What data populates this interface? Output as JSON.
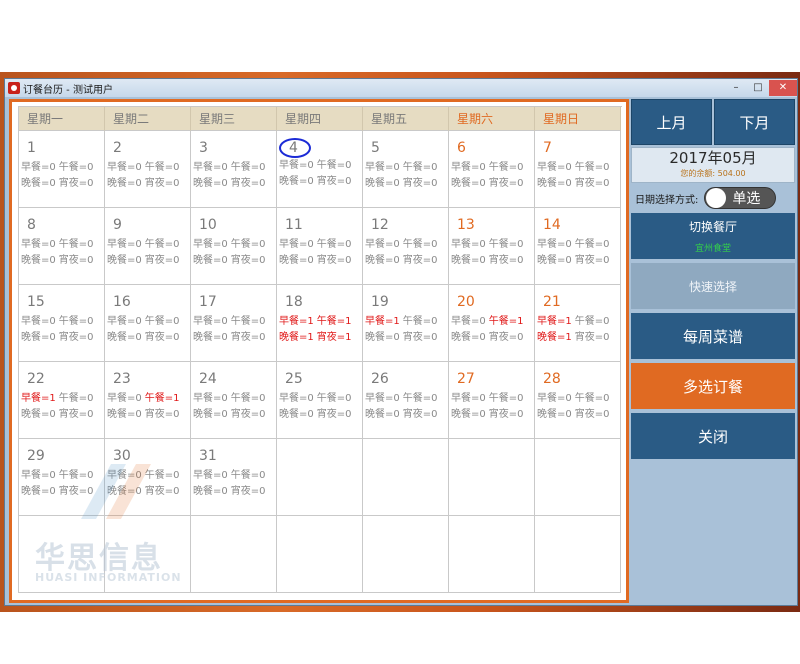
{
  "window": {
    "title": "订餐台历 - 测试用户",
    "controls": [
      "–",
      "□",
      "✕"
    ]
  },
  "calendar": {
    "weekdays": [
      "星期一",
      "星期二",
      "星期三",
      "星期四",
      "星期五",
      "星期六",
      "星期日"
    ],
    "days": [
      {
        "num": "1",
        "weekend": false,
        "today": false,
        "meals": [
          [
            "早餐=0",
            0
          ],
          [
            "午餐=0",
            0
          ],
          [
            "晚餐=0",
            0
          ],
          [
            "宵夜=0",
            0
          ]
        ]
      },
      {
        "num": "2",
        "weekend": false,
        "today": false,
        "meals": [
          [
            "早餐=0",
            0
          ],
          [
            "午餐=0",
            0
          ],
          [
            "晚餐=0",
            0
          ],
          [
            "宵夜=0",
            0
          ]
        ]
      },
      {
        "num": "3",
        "weekend": false,
        "today": false,
        "meals": [
          [
            "早餐=0",
            0
          ],
          [
            "午餐=0",
            0
          ],
          [
            "晚餐=0",
            0
          ],
          [
            "宵夜=0",
            0
          ]
        ]
      },
      {
        "num": "4",
        "weekend": false,
        "today": true,
        "meals": [
          [
            "早餐=0",
            0
          ],
          [
            "午餐=0",
            0
          ],
          [
            "晚餐=0",
            0
          ],
          [
            "宵夜=0",
            0
          ]
        ]
      },
      {
        "num": "5",
        "weekend": false,
        "today": false,
        "meals": [
          [
            "早餐=0",
            0
          ],
          [
            "午餐=0",
            0
          ],
          [
            "晚餐=0",
            0
          ],
          [
            "宵夜=0",
            0
          ]
        ]
      },
      {
        "num": "6",
        "weekend": true,
        "today": false,
        "meals": [
          [
            "早餐=0",
            0
          ],
          [
            "午餐=0",
            0
          ],
          [
            "晚餐=0",
            0
          ],
          [
            "宵夜=0",
            0
          ]
        ]
      },
      {
        "num": "7",
        "weekend": true,
        "today": false,
        "meals": [
          [
            "早餐=0",
            0
          ],
          [
            "午餐=0",
            0
          ],
          [
            "晚餐=0",
            0
          ],
          [
            "宵夜=0",
            0
          ]
        ]
      },
      {
        "num": "8",
        "weekend": false,
        "today": false,
        "meals": [
          [
            "早餐=0",
            0
          ],
          [
            "午餐=0",
            0
          ],
          [
            "晚餐=0",
            0
          ],
          [
            "宵夜=0",
            0
          ]
        ]
      },
      {
        "num": "9",
        "weekend": false,
        "today": false,
        "meals": [
          [
            "早餐=0",
            0
          ],
          [
            "午餐=0",
            0
          ],
          [
            "晚餐=0",
            0
          ],
          [
            "宵夜=0",
            0
          ]
        ]
      },
      {
        "num": "10",
        "weekend": false,
        "today": false,
        "meals": [
          [
            "早餐=0",
            0
          ],
          [
            "午餐=0",
            0
          ],
          [
            "晚餐=0",
            0
          ],
          [
            "宵夜=0",
            0
          ]
        ]
      },
      {
        "num": "11",
        "weekend": false,
        "today": false,
        "meals": [
          [
            "早餐=0",
            0
          ],
          [
            "午餐=0",
            0
          ],
          [
            "晚餐=0",
            0
          ],
          [
            "宵夜=0",
            0
          ]
        ]
      },
      {
        "num": "12",
        "weekend": false,
        "today": false,
        "meals": [
          [
            "早餐=0",
            0
          ],
          [
            "午餐=0",
            0
          ],
          [
            "晚餐=0",
            0
          ],
          [
            "宵夜=0",
            0
          ]
        ]
      },
      {
        "num": "13",
        "weekend": true,
        "today": false,
        "meals": [
          [
            "早餐=0",
            0
          ],
          [
            "午餐=0",
            0
          ],
          [
            "晚餐=0",
            0
          ],
          [
            "宵夜=0",
            0
          ]
        ]
      },
      {
        "num": "14",
        "weekend": true,
        "today": false,
        "meals": [
          [
            "早餐=0",
            0
          ],
          [
            "午餐=0",
            0
          ],
          [
            "晚餐=0",
            0
          ],
          [
            "宵夜=0",
            0
          ]
        ]
      },
      {
        "num": "15",
        "weekend": false,
        "today": false,
        "meals": [
          [
            "早餐=0",
            0
          ],
          [
            "午餐=0",
            0
          ],
          [
            "晚餐=0",
            0
          ],
          [
            "宵夜=0",
            0
          ]
        ]
      },
      {
        "num": "16",
        "weekend": false,
        "today": false,
        "meals": [
          [
            "早餐=0",
            0
          ],
          [
            "午餐=0",
            0
          ],
          [
            "晚餐=0",
            0
          ],
          [
            "宵夜=0",
            0
          ]
        ]
      },
      {
        "num": "17",
        "weekend": false,
        "today": false,
        "meals": [
          [
            "早餐=0",
            0
          ],
          [
            "午餐=0",
            0
          ],
          [
            "晚餐=0",
            0
          ],
          [
            "宵夜=0",
            0
          ]
        ]
      },
      {
        "num": "18",
        "weekend": false,
        "today": false,
        "meals": [
          [
            "早餐=1",
            1
          ],
          [
            "午餐=1",
            1
          ],
          [
            "晚餐=1",
            1
          ],
          [
            "宵夜=1",
            1
          ]
        ]
      },
      {
        "num": "19",
        "weekend": false,
        "today": false,
        "meals": [
          [
            "早餐=1",
            1
          ],
          [
            "午餐=0",
            0
          ],
          [
            "晚餐=0",
            0
          ],
          [
            "宵夜=0",
            0
          ]
        ]
      },
      {
        "num": "20",
        "weekend": true,
        "today": false,
        "meals": [
          [
            "早餐=0",
            0
          ],
          [
            "午餐=1",
            1
          ],
          [
            "晚餐=0",
            0
          ],
          [
            "宵夜=0",
            0
          ]
        ]
      },
      {
        "num": "21",
        "weekend": true,
        "today": false,
        "meals": [
          [
            "早餐=1",
            1
          ],
          [
            "午餐=0",
            0
          ],
          [
            "晚餐=1",
            1
          ],
          [
            "宵夜=0",
            0
          ]
        ]
      },
      {
        "num": "22",
        "weekend": false,
        "today": false,
        "meals": [
          [
            "早餐=1",
            1
          ],
          [
            "午餐=0",
            0
          ],
          [
            "晚餐=0",
            0
          ],
          [
            "宵夜=0",
            0
          ]
        ]
      },
      {
        "num": "23",
        "weekend": false,
        "today": false,
        "meals": [
          [
            "早餐=0",
            0
          ],
          [
            "午餐=1",
            1
          ],
          [
            "晚餐=0",
            0
          ],
          [
            "宵夜=0",
            0
          ]
        ]
      },
      {
        "num": "24",
        "weekend": false,
        "today": false,
        "meals": [
          [
            "早餐=0",
            0
          ],
          [
            "午餐=0",
            0
          ],
          [
            "晚餐=0",
            0
          ],
          [
            "宵夜=0",
            0
          ]
        ]
      },
      {
        "num": "25",
        "weekend": false,
        "today": false,
        "meals": [
          [
            "早餐=0",
            0
          ],
          [
            "午餐=0",
            0
          ],
          [
            "晚餐=0",
            0
          ],
          [
            "宵夜=0",
            0
          ]
        ]
      },
      {
        "num": "26",
        "weekend": false,
        "today": false,
        "meals": [
          [
            "早餐=0",
            0
          ],
          [
            "午餐=0",
            0
          ],
          [
            "晚餐=0",
            0
          ],
          [
            "宵夜=0",
            0
          ]
        ]
      },
      {
        "num": "27",
        "weekend": true,
        "today": false,
        "meals": [
          [
            "早餐=0",
            0
          ],
          [
            "午餐=0",
            0
          ],
          [
            "晚餐=0",
            0
          ],
          [
            "宵夜=0",
            0
          ]
        ]
      },
      {
        "num": "28",
        "weekend": true,
        "today": false,
        "meals": [
          [
            "早餐=0",
            0
          ],
          [
            "午餐=0",
            0
          ],
          [
            "晚餐=0",
            0
          ],
          [
            "宵夜=0",
            0
          ]
        ]
      },
      {
        "num": "29",
        "weekend": false,
        "today": false,
        "meals": [
          [
            "早餐=0",
            0
          ],
          [
            "午餐=0",
            0
          ],
          [
            "晚餐=0",
            0
          ],
          [
            "宵夜=0",
            0
          ]
        ]
      },
      {
        "num": "30",
        "weekend": false,
        "today": false,
        "meals": [
          [
            "早餐=0",
            0
          ],
          [
            "午餐=0",
            0
          ],
          [
            "晚餐=0",
            0
          ],
          [
            "宵夜=0",
            0
          ]
        ]
      },
      {
        "num": "31",
        "weekend": false,
        "today": false,
        "meals": [
          [
            "早餐=0",
            0
          ],
          [
            "午餐=0",
            0
          ],
          [
            "晚餐=0",
            0
          ],
          [
            "宵夜=0",
            0
          ]
        ]
      }
    ],
    "leading_blanks": 0,
    "total_cells": 42
  },
  "watermark": {
    "cn": "华思信息",
    "en": "HUASI INFORMATION"
  },
  "side": {
    "prev_month": "上月",
    "next_month": "下月",
    "month_title": "2017年05月",
    "balance": "您的余额: 504.00",
    "select_mode_label": "日期选择方式:",
    "select_mode_value": "单选",
    "switch_restaurant": "切换餐厅",
    "restaurant_name": "宜州食堂",
    "quick_select": "快速选择",
    "weekly_menu": "每周菜谱",
    "multi_order": "多选订餐",
    "close": "关闭"
  },
  "colors": {
    "accent": "#e06a22",
    "button": "#2a5b85",
    "ordered": "#e01818",
    "restaurant": "#34d04a"
  }
}
